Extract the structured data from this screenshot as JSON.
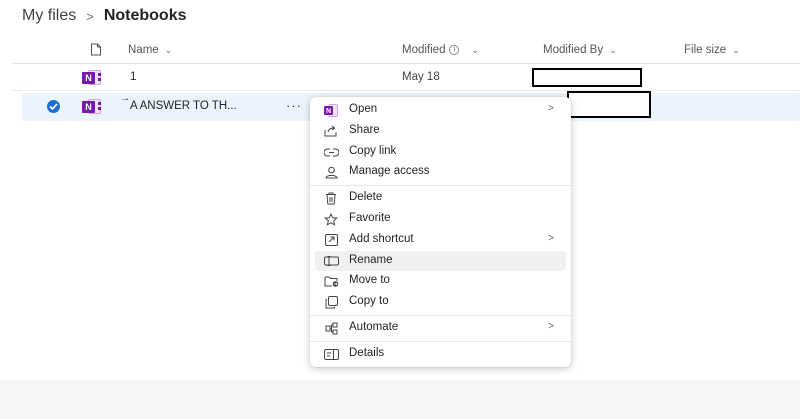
{
  "breadcrumb": {
    "root": "My files",
    "separator": ">",
    "current": "Notebooks"
  },
  "columns": {
    "name": "Name",
    "modified": "Modified",
    "modified_by": "Modified By",
    "file_size": "File size"
  },
  "rows": [
    {
      "name": "1",
      "modified": "May 18",
      "icon": "onenote-icon",
      "selected": false
    },
    {
      "name": "A ANSWER TO TH...",
      "modified": "",
      "icon": "onenote-icon",
      "selected": true
    }
  ],
  "context_menu": {
    "items": [
      {
        "label": "Open",
        "icon": "onenote-icon",
        "submenu": true
      },
      {
        "label": "Share",
        "icon": "share-icon",
        "submenu": false
      },
      {
        "label": "Copy link",
        "icon": "link-icon",
        "submenu": false
      },
      {
        "label": "Manage access",
        "icon": "person-icon",
        "submenu": false
      },
      {
        "label": "Delete",
        "icon": "trash-icon",
        "submenu": false
      },
      {
        "label": "Favorite",
        "icon": "star-icon",
        "submenu": false
      },
      {
        "label": "Add shortcut",
        "icon": "shortcut-icon",
        "submenu": true
      },
      {
        "label": "Rename",
        "icon": "rename-icon",
        "submenu": false,
        "hovered": true
      },
      {
        "label": "Move to",
        "icon": "move-icon",
        "submenu": false
      },
      {
        "label": "Copy to",
        "icon": "copy-icon",
        "submenu": false
      },
      {
        "label": "Automate",
        "icon": "automate-icon",
        "submenu": true
      },
      {
        "label": "Details",
        "icon": "details-icon",
        "submenu": false
      }
    ],
    "submenu_arrow": ">"
  },
  "colors": {
    "onenote_purple": "#7719aa",
    "selection_bg": "#ebf3fc",
    "check_blue": "#1e6fd1"
  }
}
